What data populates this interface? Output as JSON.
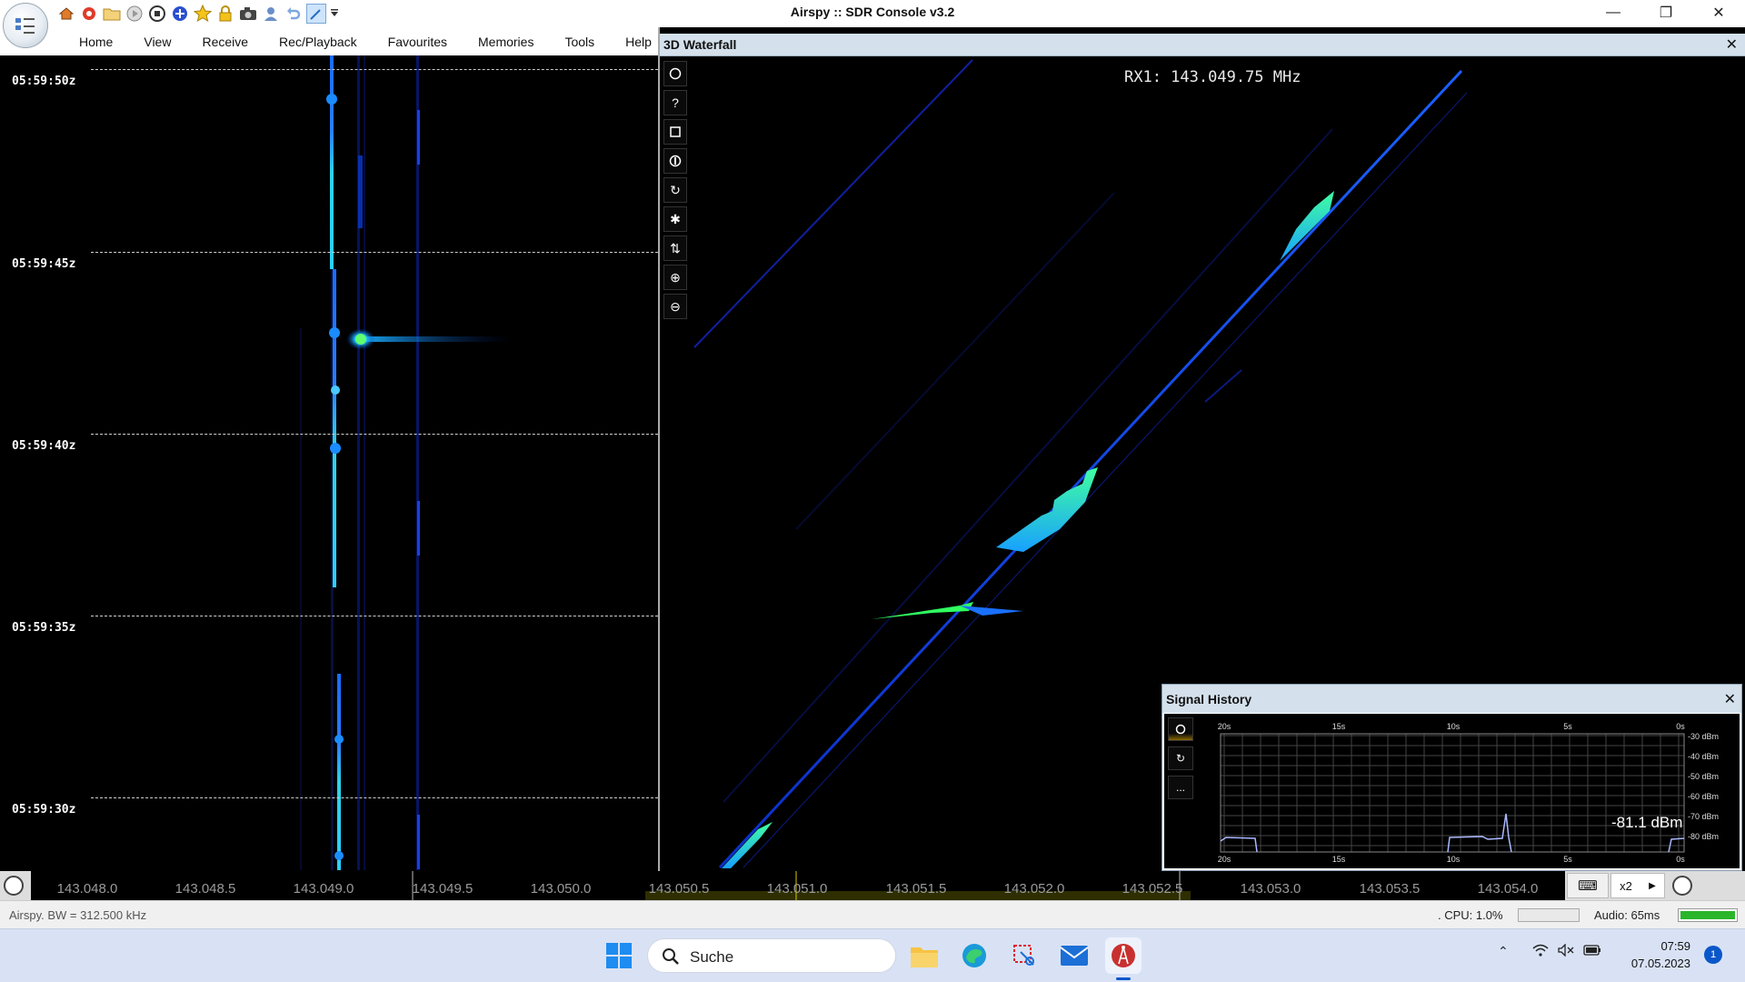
{
  "window": {
    "title": "Airspy :: SDR Console v3.2",
    "controls": [
      "minimize",
      "restore",
      "close"
    ]
  },
  "quick_access_icons": [
    "home-icon",
    "lifebuoy-icon",
    "folder-icon",
    "play-icon",
    "stop-icon",
    "add-icon",
    "star-icon",
    "lock-icon",
    "camera-icon",
    "user-icon",
    "undo-icon",
    "edit-icon",
    "dropdown-arrow-icon"
  ],
  "menu": [
    "Home",
    "View",
    "Receive",
    "Rec/Playback",
    "Favourites",
    "Memories",
    "Tools",
    "Help"
  ],
  "left_waterfall": {
    "timestamps": [
      "05:59:50z",
      "05:59:45z",
      "05:59:40z",
      "05:59:35z",
      "05:59:30z"
    ]
  },
  "waterfall3d": {
    "title": "3D Waterfall",
    "close": "✕",
    "rx_label": "RX1: 143.049.75 MHz",
    "tools": [
      "circle-icon",
      "help-icon",
      "square-icon",
      "info-icon",
      "rotate-icon",
      "asterisk-icon",
      "swap-vertical-icon",
      "zoom-in-icon",
      "zoom-out-icon"
    ]
  },
  "signal_history": {
    "title": "Signal History",
    "close": "✕",
    "time_ticks": [
      "20s",
      "15s",
      "10s",
      "5s",
      "0s"
    ],
    "dbm_ticks": [
      "-30 dBm",
      "-40 dBm",
      "-50 dBm",
      "-60 dBm",
      "-70 dBm",
      "-80 dBm"
    ],
    "current_value": "-81.1 dBm",
    "tools": [
      "circle-icon",
      "refresh-icon",
      "more-icon"
    ],
    "more_label": "..."
  },
  "frequency_scale": {
    "ticks": [
      "143.048.0",
      "143.048.5",
      "143.049.0",
      "143.049.5",
      "143.050.0",
      "143.050.5",
      "143.051.0",
      "143.051.5",
      "143.052.0",
      "143.052.5",
      "143.053.0",
      "143.053.5",
      "143.054.0"
    ],
    "zoom": "x2"
  },
  "status_bar": {
    "left": "Airspy. BW = 312.500 kHz",
    "cpu": ". CPU: 1.0%",
    "cpu_level": 0.01,
    "audio": "Audio: 65ms",
    "audio_level": 1.0
  },
  "taskbar": {
    "search_label": "Suche",
    "apps": [
      "windows-start-icon",
      "file-explorer-icon",
      "edge-icon",
      "snipping-tool-icon",
      "mail-icon",
      "sdr-console-icon"
    ],
    "time": "07:59",
    "date": "07.05.2023",
    "notification_count": "1"
  },
  "colors": {
    "accent_blue": "#0b57c9",
    "waterfall_cyan": "#00c8ff",
    "waterfall_green": "#40ff90",
    "panel_header": "#d4e1ec"
  }
}
